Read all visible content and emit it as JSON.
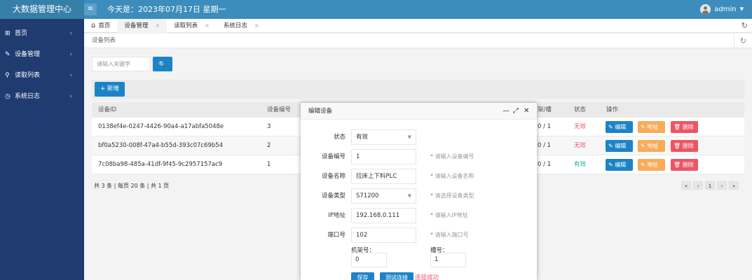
{
  "header": {
    "app_title": "大数据管理中心",
    "menu_icon": "≡",
    "today": "今天是：2023年07月17日 星期一",
    "user": "admin",
    "user_caret": "▼"
  },
  "sidebar": {
    "items": [
      {
        "icon": "⊞",
        "label": "首页"
      },
      {
        "icon": "✎",
        "label": "设备管理"
      },
      {
        "icon": "⚲",
        "label": "读取列表"
      },
      {
        "icon": "◷",
        "label": "系统日志"
      }
    ],
    "arrow": "›"
  },
  "tabs": {
    "items": [
      {
        "label": "首页",
        "icon": "⌂"
      },
      {
        "label": "设备管理",
        "close": "×"
      },
      {
        "label": "读取列表",
        "close": "×"
      },
      {
        "label": "系统日志",
        "close": "×"
      }
    ],
    "refresh": "↻"
  },
  "page": {
    "title": "设备列表",
    "reload": "↻"
  },
  "search": {
    "placeholder": "请输入关键字",
    "button_icon": "🔍"
  },
  "toolbar": {
    "add_label": "+ 新增"
  },
  "table": {
    "columns": [
      "设备ID",
      "设备编号",
      "架/槽",
      "状态",
      "操作"
    ],
    "rows": [
      {
        "id": "0138ef4e-0247-4426-90a4-a17abfa5048e",
        "code": "3",
        "rack": "0 / 1",
        "status": "无效"
      },
      {
        "id": "bf0a5230-008f-47a4-b55d-393c07c69b54",
        "code": "2",
        "rack": "0 / 1",
        "status": "无效"
      },
      {
        "id": "7c08ba98-485a-41df-9f45-9c2957157ac9",
        "code": "1",
        "rack": "0 / 1",
        "status": "有效"
      }
    ],
    "actions": {
      "edit": "编辑",
      "addr": "地址",
      "del": "删除"
    }
  },
  "pagination": {
    "info": "共 3 条 | 每页 20 条 | 共 1 页",
    "buttons": [
      "«",
      "‹",
      "1",
      "›",
      "»"
    ]
  },
  "modal": {
    "title": "编辑设备",
    "controls": {
      "min": "—",
      "max": "⤢",
      "close": "✕"
    },
    "fields": [
      {
        "label": "状态",
        "value": "有效",
        "select": true,
        "hint": ""
      },
      {
        "label": "设备编号",
        "value": "1",
        "select": false,
        "hint": "请输入设备编号"
      },
      {
        "label": "设备名称",
        "value": "拉床上下料PLC",
        "select": false,
        "hint": "请输入设备名称"
      },
      {
        "label": "设备类型",
        "value": "S71200",
        "select": true,
        "hint": "请选择设备类型"
      },
      {
        "label": "IP地址",
        "value": "192.168.0.111",
        "select": false,
        "hint": "请输入IP地址"
      },
      {
        "label": "端口号",
        "value": "102",
        "select": false,
        "hint": "请输入端口号"
      }
    ],
    "rack_label": "机架号：",
    "rack_value": "0",
    "slot_label": "槽号：",
    "slot_value": "1",
    "save_label": "保存",
    "test_label": "测试连接",
    "conn_status": "连接成功",
    "hint_star": "*"
  },
  "colors": {
    "header": "#3c8dbc",
    "sidebar": "#1f3b6f",
    "primary": "#1c84c6",
    "warning": "#f8ac59",
    "danger": "#ed5565",
    "success": "#1ab394"
  }
}
